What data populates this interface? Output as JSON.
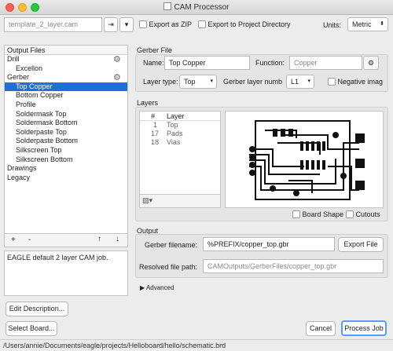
{
  "window": {
    "title": "CAM Processor"
  },
  "toolbar": {
    "template": "template_2_layer.cam",
    "export_zip": "Export as ZIP",
    "export_project": "Export to Project Directory",
    "units_label": "Units:",
    "units_value": "Metric"
  },
  "left": {
    "header": "Output Files",
    "tree": [
      "Drill",
      "Excellon",
      "Gerber",
      "Top Copper",
      "Bottom Copper",
      "Profile",
      "Soldermask Top",
      "Soldermask Bottom",
      "Solderpaste Top",
      "Solderpaste Bottom",
      "Silkscreen Top",
      "Silkscreen Bottom",
      "Drawings",
      "Legacy"
    ],
    "add": "+",
    "remove": "-",
    "up": "↑",
    "down": "↓",
    "description": "EAGLE default 2 layer CAM job.",
    "edit_desc": "Edit Description...",
    "select_board": "Select Board..."
  },
  "gerber": {
    "section": "Gerber File",
    "name_label": "Name:",
    "name_value": "Top Copper",
    "function_label": "Function:",
    "function_value": "Copper",
    "layer_type_label": "Layer type:",
    "layer_type_value": "Top",
    "layer_number_label": "Gerber layer numbe",
    "layer_number_value": "L1",
    "negative": "Negative imag"
  },
  "layers": {
    "section": "Layers",
    "col_num": "#",
    "col_layer": "Layer",
    "rows": [
      {
        "num": "1",
        "name": "Top"
      },
      {
        "num": "17",
        "name": "Pads"
      },
      {
        "num": "18",
        "name": "Vias"
      }
    ],
    "board_shape": "Board Shape",
    "cutouts": "Cutouts"
  },
  "output": {
    "section": "Output",
    "filename_label": "Gerber filename:",
    "filename_value": "%PREFIX/copper_top.gbr",
    "export_file": "Export File",
    "resolved_label": "Resolved file path:",
    "resolved_value": "CAMOutputs/GerberFiles/copper_top.gbr",
    "advanced": "Advanced"
  },
  "actions": {
    "cancel": "Cancel",
    "process": "Process Job"
  },
  "status": {
    "path": "/Users/annie/Documents/eagle/projects/Helloboard/hello/schematic.brd"
  }
}
